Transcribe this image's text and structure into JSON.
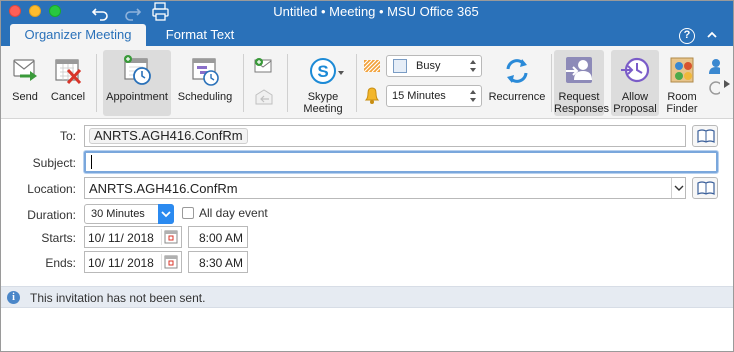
{
  "window": {
    "title": "Untitled • Meeting • MSU Office 365"
  },
  "tabs": [
    {
      "label": "Organizer Meeting",
      "active": true
    },
    {
      "label": "Format Text",
      "active": false
    }
  ],
  "ribbon": {
    "send": "Send",
    "cancel": "Cancel",
    "appointment": "Appointment",
    "scheduling": "Scheduling",
    "skype_meeting": [
      "Skype",
      "Meeting"
    ],
    "show_as": "Busy",
    "reminder": "15 Minutes",
    "recurrence": "Recurrence",
    "request_responses": [
      "Request",
      "Responses"
    ],
    "allow_proposal": [
      "Allow",
      "Proposal"
    ],
    "room_finder": [
      "Room",
      "Finder"
    ]
  },
  "form": {
    "to_label": "To:",
    "to_value": "ANRTS.AGH416.ConfRm",
    "subject_label": "Subject:",
    "subject_value": "",
    "location_label": "Location:",
    "location_value": "ANRTS.AGH416.ConfRm",
    "duration_label": "Duration:",
    "duration_value": "30 Minutes",
    "all_day_label": "All day event",
    "all_day_checked": false,
    "starts_label": "Starts:",
    "start_date": "10/ 11/ 2018",
    "start_time": "8:00 AM",
    "ends_label": "Ends:",
    "end_date": "10/ 11/ 2018",
    "end_time": "8:30 AM"
  },
  "info_bar": {
    "message": "This invitation has not been sent."
  },
  "colors": {
    "titlebar": "#2a71b9",
    "accent": "#2b8af0",
    "info_bar": "#e6ebf2"
  }
}
